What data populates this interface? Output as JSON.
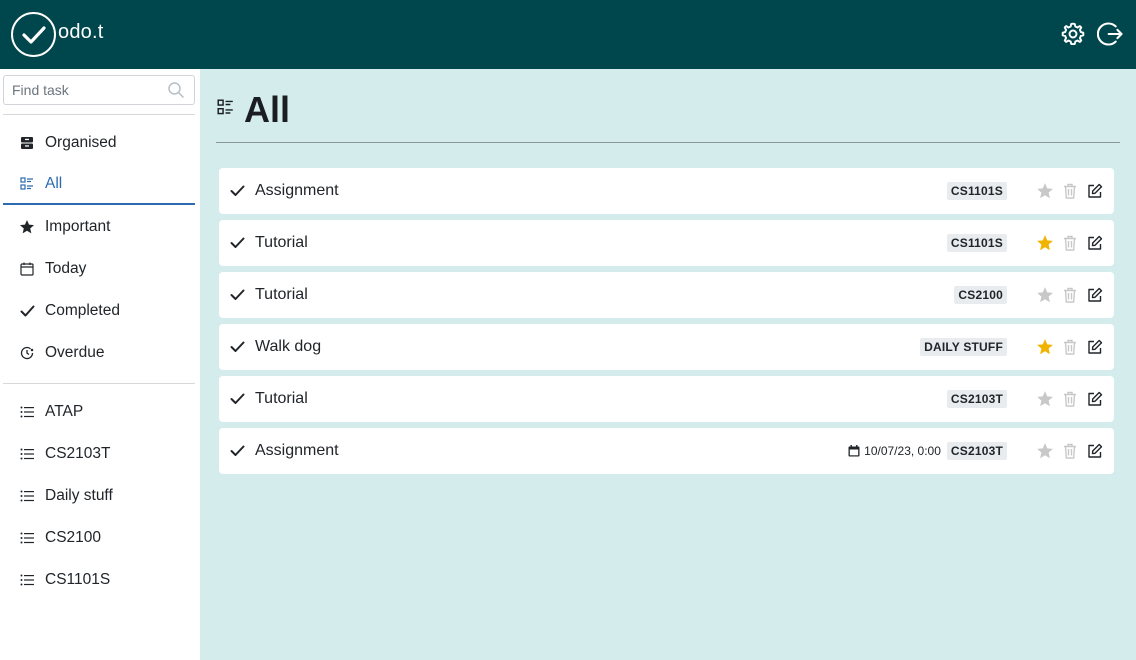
{
  "app": {
    "logo_text": "odo.t"
  },
  "search": {
    "placeholder": "Find task"
  },
  "nav": {
    "filters": [
      {
        "label": "Organised",
        "icon": "archive-icon"
      },
      {
        "label": "All",
        "icon": "list-details-icon",
        "active": true
      },
      {
        "label": "Important",
        "icon": "star-icon"
      },
      {
        "label": "Today",
        "icon": "calendar-icon"
      },
      {
        "label": "Completed",
        "icon": "check-icon"
      },
      {
        "label": "Overdue",
        "icon": "clock-icon"
      }
    ],
    "lists": [
      {
        "label": "ATAP",
        "icon": "list-icon"
      },
      {
        "label": "CS2103T",
        "icon": "list-icon"
      },
      {
        "label": "Daily stuff",
        "icon": "list-icon"
      },
      {
        "label": "CS2100",
        "icon": "list-icon"
      },
      {
        "label": "CS1101S",
        "icon": "list-icon"
      }
    ]
  },
  "main": {
    "title": "All"
  },
  "tasks": [
    {
      "name": "Assignment",
      "tag": "CS1101S",
      "important": false,
      "due": ""
    },
    {
      "name": "Tutorial",
      "tag": "CS1101S",
      "important": true,
      "due": ""
    },
    {
      "name": "Tutorial",
      "tag": "CS2100",
      "important": false,
      "due": ""
    },
    {
      "name": "Walk dog",
      "tag": "DAILY STUFF",
      "important": true,
      "due": ""
    },
    {
      "name": "Tutorial",
      "tag": "CS2103T",
      "important": false,
      "due": ""
    },
    {
      "name": "Assignment",
      "tag": "CS2103T",
      "important": false,
      "due": "10/07/23, 0:00"
    }
  ],
  "colors": {
    "header": "#00474d",
    "background": "#d4edec",
    "star_active": "#f0b400",
    "star_inactive": "#c8c8c8",
    "active_nav": "#2b6cb0"
  }
}
